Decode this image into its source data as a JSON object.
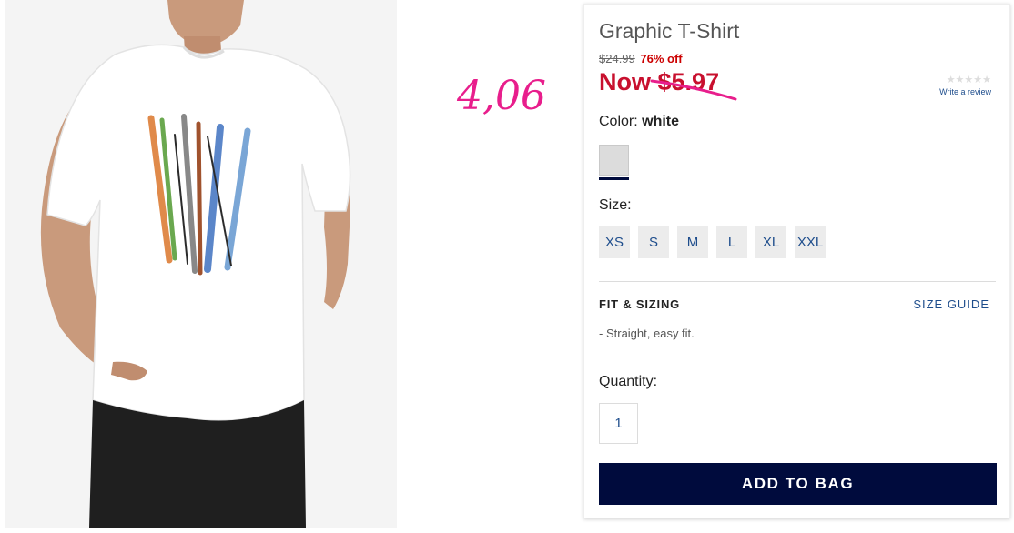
{
  "annotation": {
    "text": "4,06",
    "color": "#e81e8c"
  },
  "product": {
    "title": "Graphic T-Shirt",
    "original_price": "$24.99",
    "discount": "76% off",
    "now_label": "Now",
    "now_price": "$5.97",
    "rating": {
      "stars": "★★★★★",
      "review_link": "Write a review"
    },
    "color": {
      "label": "Color:",
      "value": "white"
    },
    "size": {
      "label": "Size:",
      "options": [
        "XS",
        "S",
        "M",
        "L",
        "XL",
        "XXL"
      ]
    },
    "fit": {
      "heading": "FIT & SIZING",
      "guide_link": "SIZE GUIDE",
      "note": "Straight, easy fit."
    },
    "quantity": {
      "label": "Quantity:",
      "value": "1"
    },
    "add_button": "ADD TO BAG"
  },
  "colors": {
    "brand_navy": "#000b3d",
    "sale_red": "#c8102e",
    "link_blue": "#1e4d8c"
  }
}
